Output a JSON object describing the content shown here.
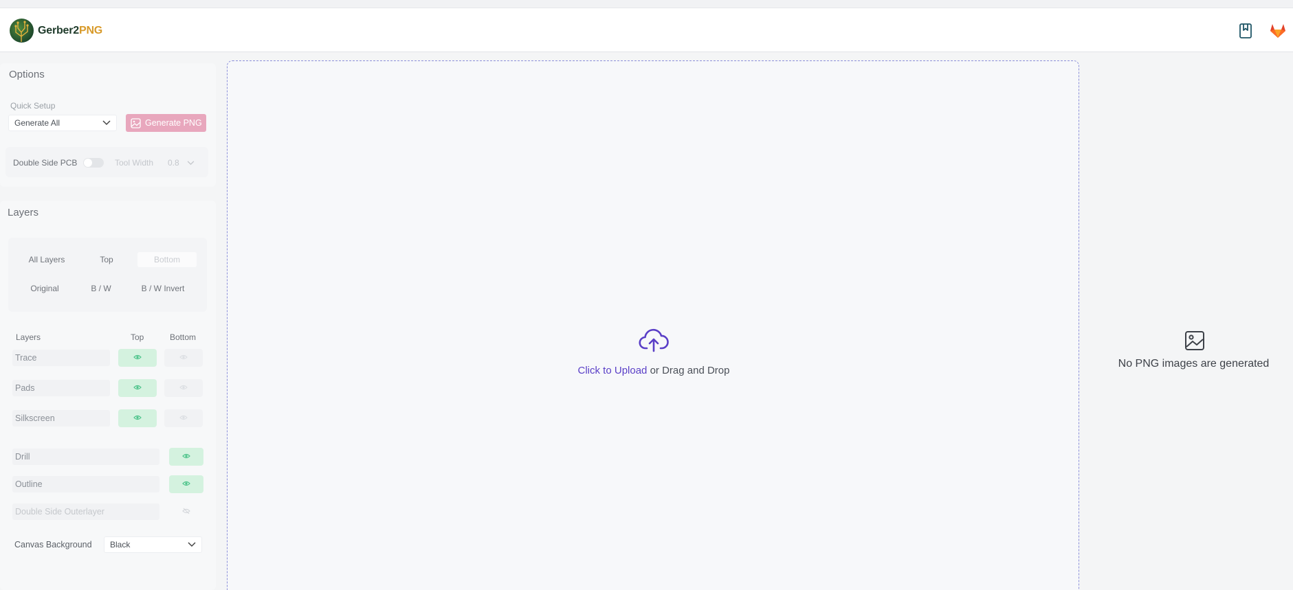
{
  "header": {
    "brand_main": "Gerber2",
    "brand_accent": "PNG",
    "icons": [
      "bookmark-icon",
      "gitlab-icon"
    ]
  },
  "options": {
    "title": "Options",
    "quick_setup_label": "Quick Setup",
    "quick_setup_value": "Generate All",
    "generate_label": "Generate PNG",
    "double_side_label": "Double Side PCB",
    "double_side_enabled": false,
    "tool_width_label": "Tool Width",
    "tool_width_value": "0.8"
  },
  "layers": {
    "title": "Layers",
    "side_tabs": [
      "All Layers",
      "Top",
      "Bottom"
    ],
    "mode_tabs": [
      "Original",
      "B / W",
      "B / W Invert"
    ],
    "table_headers": {
      "layers": "Layers",
      "top": "Top",
      "bottom": "Bottom"
    },
    "rows": [
      {
        "name": "Trace",
        "top": true,
        "bottom": false
      },
      {
        "name": "Pads",
        "top": true,
        "bottom": false
      },
      {
        "name": "Silkscreen",
        "top": true,
        "bottom": false
      }
    ],
    "single_rows": [
      {
        "name": "Drill",
        "visible": true
      },
      {
        "name": "Outline",
        "visible": true
      },
      {
        "name": "Double Side Outerlayer",
        "visible": false
      }
    ],
    "canvas_bg_label": "Canvas Background",
    "canvas_bg_value": "Black"
  },
  "upload": {
    "link_text": "Click to Upload",
    "rest_text": " or Drag and Drop"
  },
  "output": {
    "empty_text": "No PNG images are generated"
  },
  "colors": {
    "accent": "#5a3fc7",
    "generate_button": "#e8a7bd",
    "eye_on": "#d4f2df"
  }
}
